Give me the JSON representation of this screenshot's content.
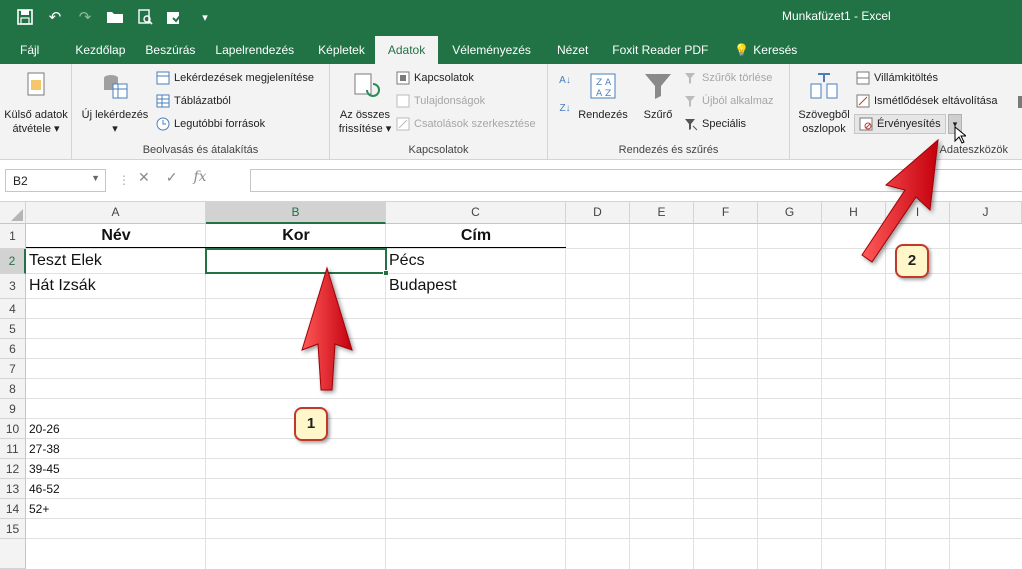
{
  "window": {
    "title": "Munkafüzet1  -  Excel"
  },
  "tabs": [
    "Fájl",
    "Kezdőlap",
    "Beszúrás",
    "Lapelrendezés",
    "Képletek",
    "Adatok",
    "Véleményezés",
    "Nézet",
    "Foxit Reader PDF",
    "Keresés"
  ],
  "active_tab": "Adatok",
  "ribbon": {
    "external": {
      "line1": "Külső adatok",
      "line2": "átvétele"
    },
    "new_query": "Új lekérdezés",
    "show_queries": "Lekérdezések megjelenítése",
    "from_table": "Táblázatból",
    "recent_sources": "Legutóbbi források",
    "group_get_transform": "Beolvasás és átalakítás",
    "refresh": {
      "line1": "Az összes",
      "line2": "frissítése"
    },
    "connections": "Kapcsolatok",
    "properties": "Tulajdonságok",
    "edit_links": "Csatolások szerkesztése",
    "group_connections": "Kapcsolatok",
    "sort": "Rendezés",
    "filter": "Szűrő",
    "clear": "Szűrők törlése",
    "reapply": "Újból alkalmaz",
    "advanced": "Speciális",
    "group_sort_filter": "Rendezés és szűrés",
    "text_to_columns": {
      "line1": "Szövegből",
      "line2": "oszlopok"
    },
    "flash_fill": "Villámkitöltés",
    "remove_duplicates": "Ismétlődések eltávolítása",
    "data_validation": "Érvényesítés",
    "group_data_tools": "Adateszközök"
  },
  "formula_bar": {
    "name_box": "B2",
    "value": ""
  },
  "columns": [
    "A",
    "B",
    "C",
    "D",
    "E",
    "F",
    "G",
    "H",
    "I",
    "J"
  ],
  "rows": [
    "1",
    "2",
    "3",
    "4",
    "5",
    "6",
    "7",
    "8",
    "9",
    "10",
    "11",
    "12",
    "13",
    "14",
    "15"
  ],
  "cells": {
    "A1": "Név",
    "B1": "Kor",
    "C1": "Cím",
    "A2": "Teszt Elek",
    "C2": "Pécs",
    "A3": "Hát Izsák",
    "C3": "Budapest",
    "A10": "20-26",
    "A11": "27-38",
    "A12": "39-45",
    "A13": "46-52",
    "A14": "52+"
  },
  "annotations": {
    "callout1": "1",
    "callout2": "2"
  },
  "colors": {
    "brand": "#217346",
    "arrow": "#e8101d"
  }
}
